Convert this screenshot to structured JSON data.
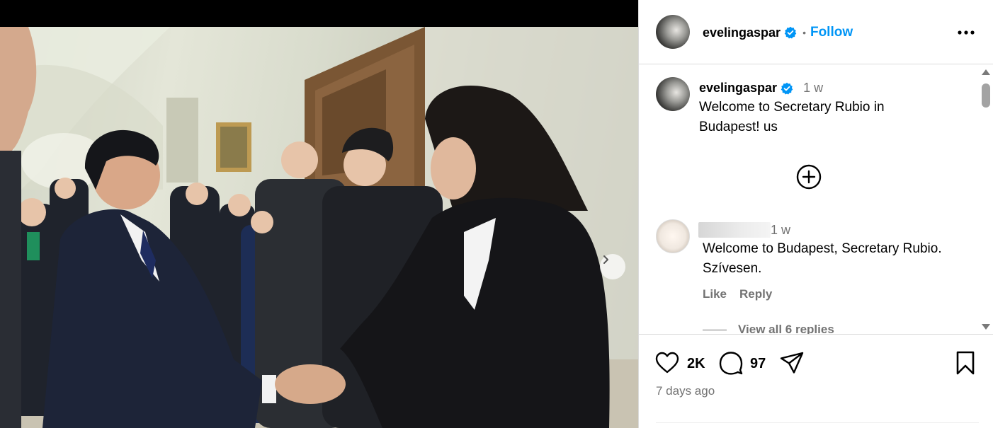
{
  "post": {
    "username": "evelingaspar",
    "follow_label": "Follow",
    "separator": "•"
  },
  "caption": {
    "username": "evelingaspar",
    "time": "1 w",
    "text": "Welcome to Secretary Rubio in Budapest! us"
  },
  "comment": {
    "time": "1 w",
    "text": "Welcome to Budapest, Secretary Rubio. Szívesen.",
    "like_label": "Like",
    "reply_label": "Reply",
    "view_replies_label": "View all 6 replies"
  },
  "stats": {
    "likes": "2K",
    "comments": "97",
    "posted_ago": "7 days ago"
  },
  "icons": {
    "verified": "verified-badge-icon",
    "more": "more-options-icon",
    "add": "add-circle-icon",
    "like": "heart-icon",
    "comment": "comment-icon",
    "share": "share-icon",
    "save": "bookmark-icon",
    "next": "chevron-right-icon"
  },
  "colors": {
    "accent": "#0095f6",
    "verified": "#0095f6",
    "muted": "#737373"
  }
}
